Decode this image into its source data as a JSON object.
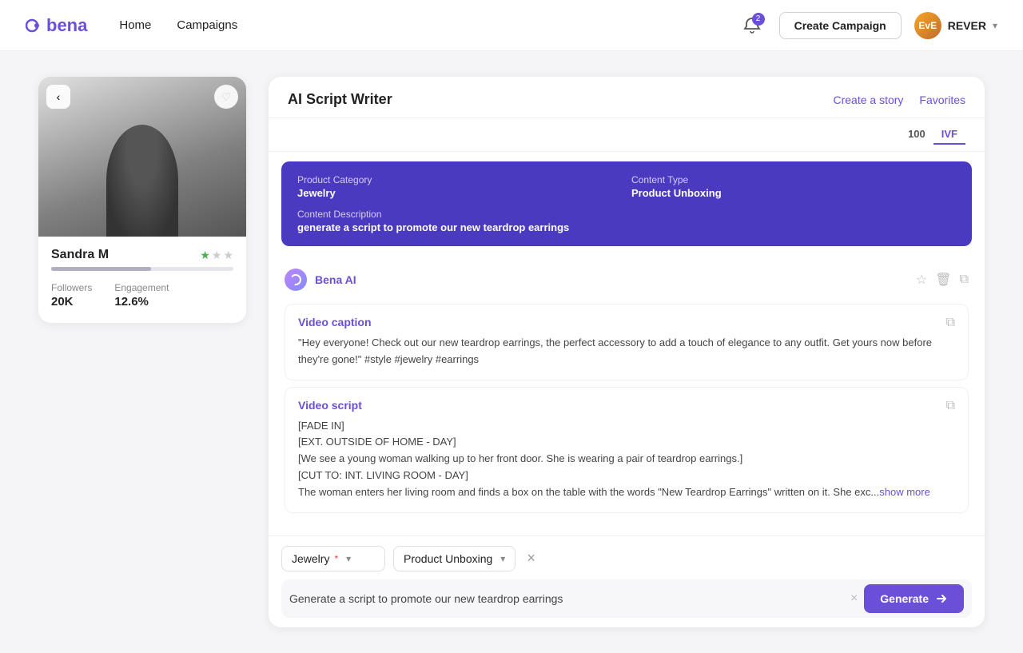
{
  "nav": {
    "logo_text": "bena",
    "links": [
      {
        "label": "Home",
        "id": "home"
      },
      {
        "label": "Campaigns",
        "id": "campaigns"
      }
    ],
    "notif_count": "2",
    "create_campaign_label": "Create Campaign",
    "user_initials": "EvE",
    "user_name": "REVER"
  },
  "influencer": {
    "name": "Sandra M",
    "stars_filled": 1,
    "stars_empty": 2,
    "followers_label": "Followers",
    "followers_value": "20K",
    "engagement_label": "Engagement",
    "engagement_value": "12.6%"
  },
  "script_writer": {
    "title": "AI Script Writer",
    "create_story_label": "Create a story",
    "favorites_label": "Favorites",
    "score_tabs": [
      "100",
      "IVF"
    ],
    "summary": {
      "product_category_label": "Product Category",
      "product_category_value": "Jewelry",
      "content_type_label": "Content Type",
      "content_type_value": "Product Unboxing",
      "content_description_label": "Content Description",
      "content_description_value": "generate a script to promote our new teardrop earrings"
    },
    "ai_name": "Bena AI",
    "video_caption_title": "Video caption",
    "video_caption_text": "\"Hey everyone! Check out our new teardrop earrings, the perfect accessory to add a touch of elegance to any outfit. Get yours now before they're gone!\" #style #jewelry #earrings",
    "video_script_title": "Video script",
    "video_script_lines": [
      "[FADE IN]",
      "[EXT. OUTSIDE OF HOME - DAY]",
      "[We see a young woman walking up to her front door. She is wearing a pair of teardrop earrings.]",
      "[CUT TO: INT. LIVING ROOM - DAY]",
      "The woman enters her living room and finds a box on the table with the words \"New Teardrop Earrings\" written on it. She exc..."
    ],
    "show_more_label": "show more",
    "bottom": {
      "category_label": "Jewelry",
      "category_required": true,
      "content_type_label": "Product Unboxing",
      "prompt_value": "Generate a script to promote our new teardrop earrings",
      "generate_label": "Generate"
    }
  }
}
